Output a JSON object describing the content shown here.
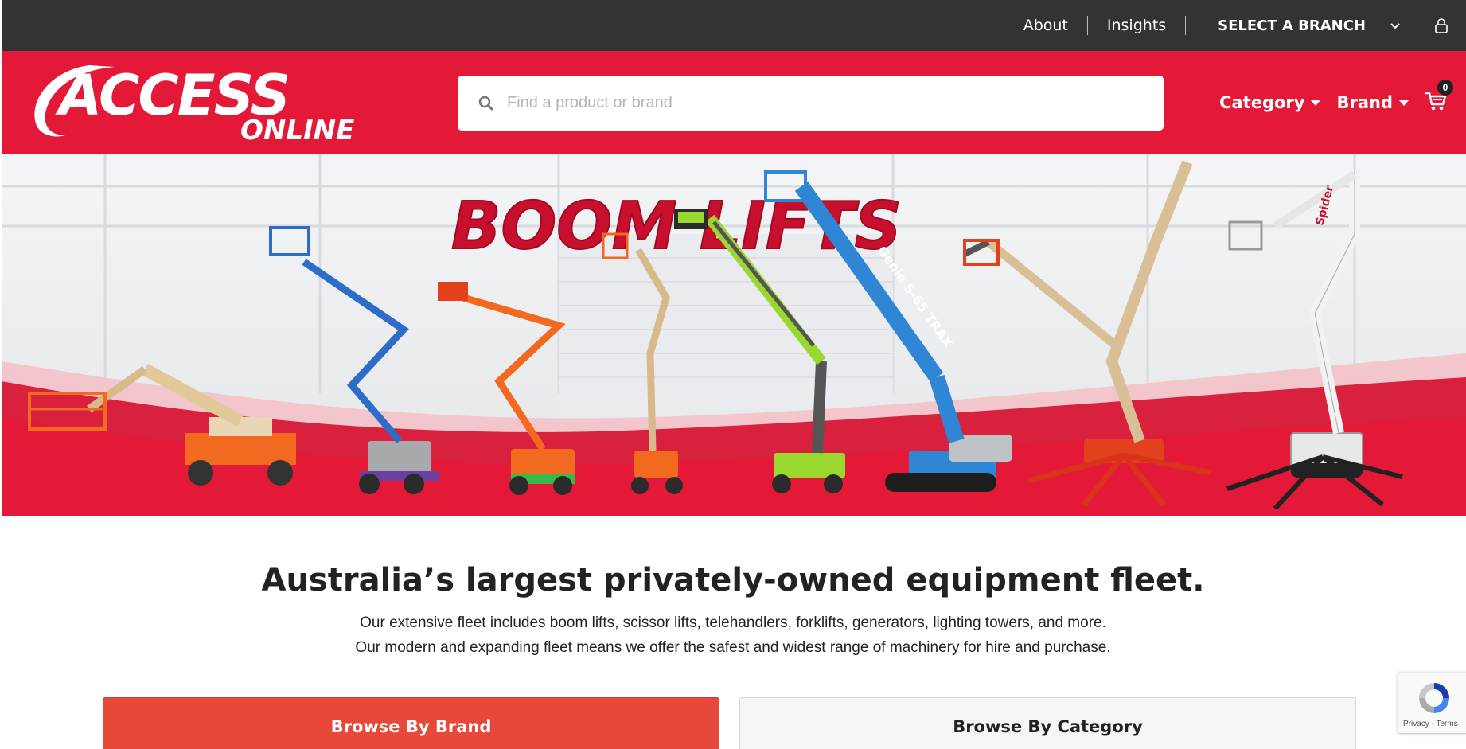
{
  "topbar": {
    "links": [
      "About",
      "Insights"
    ],
    "branch_label": "SELECT A BRANCH",
    "branch_icon": "chevron-down-icon",
    "account_icon": "user-icon"
  },
  "header": {
    "logo_text_main": "ACCESS",
    "logo_text_sub": "ONLINE",
    "search_placeholder": "Find a product or brand",
    "search_icon": "search-icon",
    "nav": [
      "Category",
      "Brand"
    ],
    "cart_count": "0",
    "cart_icon": "cart-icon"
  },
  "hero": {
    "title": "BOOM LIFTS",
    "machine_labels": [
      "Genie S-65 TRAX",
      "Spider"
    ]
  },
  "content": {
    "headline": "Australia’s largest privately-owned equipment fleet.",
    "description_line1": "Our extensive fleet includes boom lifts, scissor lifts, telehandlers, forklifts, generators, lighting towers, and more.",
    "description_line2": "Our modern and expanding fleet means we offer the safest and widest range of machinery for hire and purchase.",
    "browse_brand": "Browse By Brand",
    "browse_category": "Browse By Category"
  },
  "recaptcha": {
    "links": "Privacy - Terms"
  },
  "colors": {
    "brand_red": "#e31937",
    "topbar": "#333333",
    "button_red": "#e8483a"
  }
}
